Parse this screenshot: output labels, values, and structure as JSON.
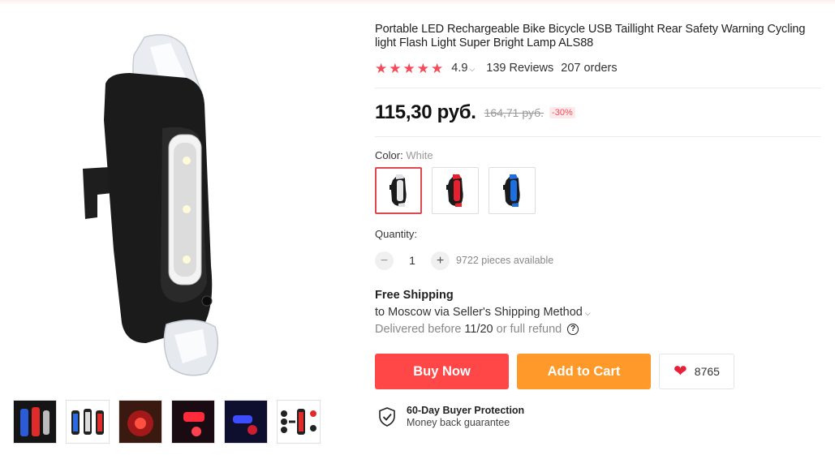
{
  "product": {
    "title": "Portable LED Rechargeable Bike Bicycle USB Taillight Rear Safety Warning Cycling light Flash Light Super Bright Lamp ALS88",
    "rating": "4.9",
    "reviews": "139 Reviews",
    "orders": "207 orders",
    "price": "115,30 руб.",
    "old_price": "164,71 руб.",
    "discount": "-30%"
  },
  "variants": {
    "color_label": "Color:",
    "selected_color": "White",
    "options": [
      {
        "name": "white",
        "accent": "#eaeaea"
      },
      {
        "name": "red",
        "accent": "#e8202e"
      },
      {
        "name": "blue",
        "accent": "#1d6fe0"
      }
    ]
  },
  "quantity": {
    "label": "Quantity:",
    "minus": "−",
    "value": "1",
    "plus": "+",
    "available": "9722 pieces available"
  },
  "shipping": {
    "title": "Free Shipping",
    "destination": "to Moscow via Seller's Shipping Method",
    "delivered_prefix": "Delivered before",
    "date": "11/20",
    "delivered_suffix": "or full refund",
    "help": "?"
  },
  "actions": {
    "buy_now": "Buy Now",
    "add_to_cart": "Add to Cart",
    "wishlist_count": "8765"
  },
  "protection": {
    "title": "60-Day Buyer Protection",
    "subtitle": "Money back guarantee"
  },
  "gallery": {
    "thumbnail_count": 6
  },
  "colors": {
    "accent_red": "#ff4747",
    "accent_orange": "#ff9a2a",
    "star": "#f44a5a"
  }
}
